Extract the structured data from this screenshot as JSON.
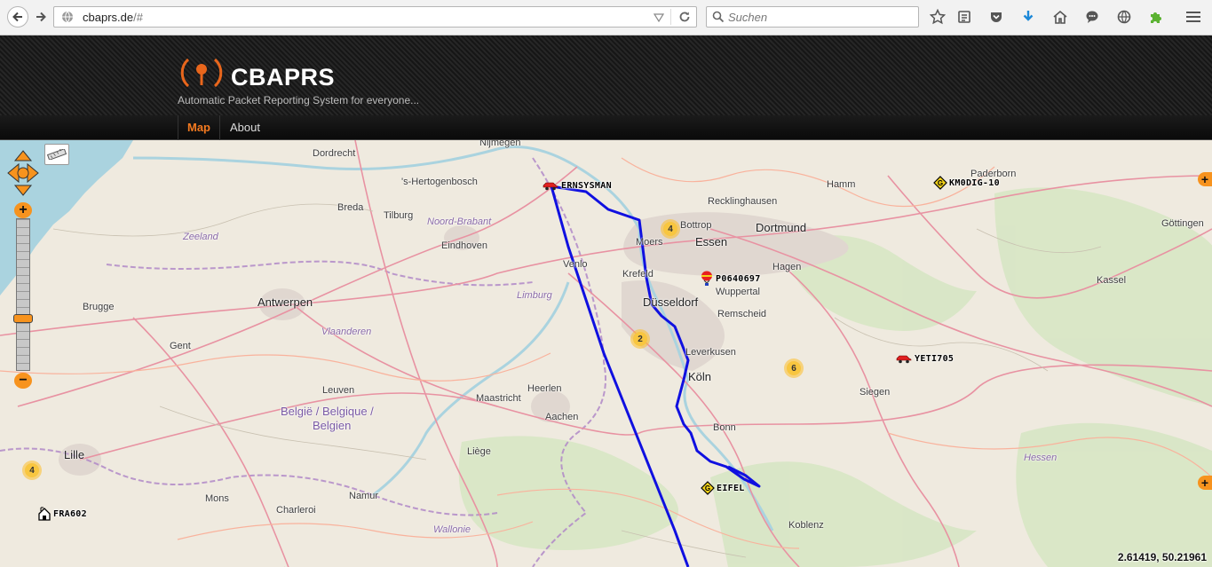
{
  "browser": {
    "url_host": "cbaprs.de",
    "url_path": "/#",
    "search_placeholder": "Suchen"
  },
  "site": {
    "title": "CBAPRS",
    "tagline": "Automatic Packet Reporting System for everyone...",
    "nav": [
      {
        "label": "Map",
        "active": true
      },
      {
        "label": "About",
        "active": false
      }
    ]
  },
  "map": {
    "places": {
      "nijmegen": "Nijmegen",
      "dordrecht": "Dordrecht",
      "hertogenbosch": "'s-Hertogenbosch",
      "breda": "Breda",
      "tilburg": "Tilburg",
      "noord_brabant": "Noord-Brabant",
      "eindhoven": "Eindhoven",
      "zeeland": "Zeeland",
      "venlo": "Venlo",
      "antwerpen": "Antwerpen",
      "limburg": "Limburg",
      "brugge": "Brugge",
      "gent": "Gent",
      "vlaanderen": "Vlaanderen",
      "leuven": "Leuven",
      "heerlen": "Heerlen",
      "maastricht": "Maastricht",
      "aachen": "Aachen",
      "belgie": "België / Belgique /",
      "belgien": "Belgien",
      "liege": "Liège",
      "lille": "Lille",
      "mons": "Mons",
      "charleroi": "Charleroi",
      "namur": "Namur",
      "wallonie": "Wallonie",
      "hamm": "Hamm",
      "paderborn": "Paderborn",
      "recklinghausen": "Recklinghausen",
      "bottrop": "Bottrop",
      "essen": "Essen",
      "dortmund": "Dortmund",
      "moers": "Moers",
      "hagen": "Hagen",
      "krefeld": "Krefeld",
      "wuppertal": "Wuppertal",
      "dusseldorf": "Düsseldorf",
      "remscheid": "Remscheid",
      "leverkusen": "Leverkusen",
      "koln": "Köln",
      "siegen": "Siegen",
      "bonn": "Bonn",
      "kassel": "Kassel",
      "gottingen": "Göttingen",
      "hessen": "Hessen",
      "koblenz": "Koblenz"
    },
    "stations": [
      {
        "label": "ERNSYSMAN",
        "icon": "car-icon"
      },
      {
        "label": "KM0DIG-10",
        "icon": "digipeater-icon"
      },
      {
        "label": "P0640697",
        "icon": "balloon-icon"
      },
      {
        "label": "YETI705",
        "icon": "car-icon"
      },
      {
        "label": "EIFEL",
        "icon": "digipeater-icon"
      },
      {
        "label": "FRA602",
        "icon": "house-icon"
      }
    ],
    "clusters": [
      "4",
      "2",
      "6",
      "4"
    ],
    "coordinates": "2.61419, 50.21961",
    "track_color": "#1010e0",
    "accent_color": "#f7931e"
  }
}
